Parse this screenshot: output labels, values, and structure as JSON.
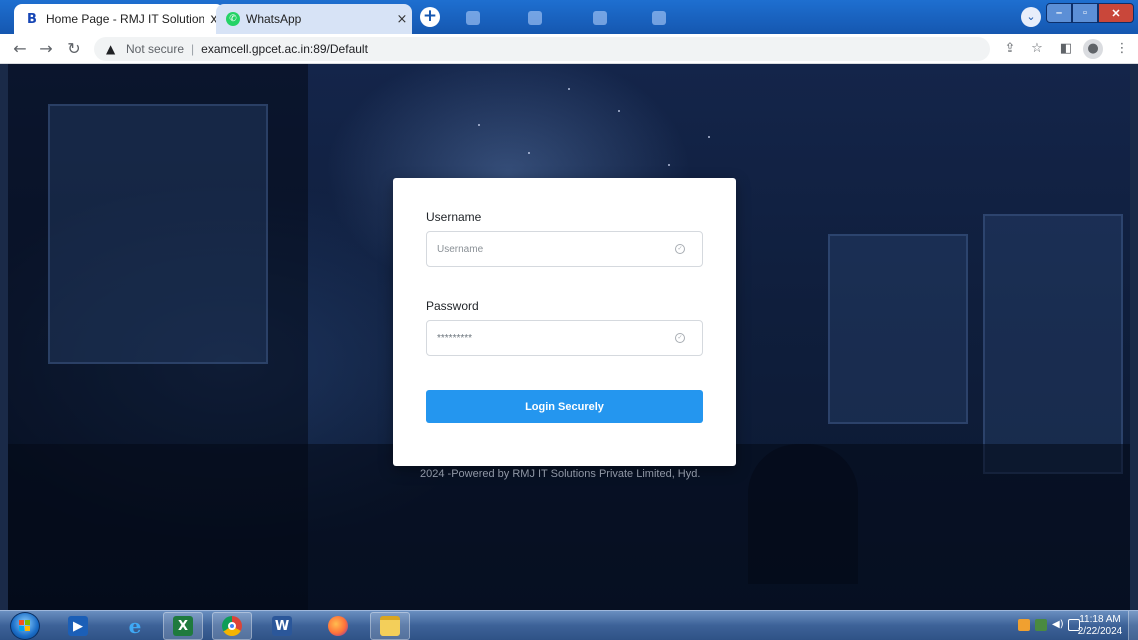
{
  "browser": {
    "tabs": [
      {
        "favicon": "B",
        "title": "Home Page - RMJ IT Solutions Pvt",
        "close": "x",
        "active": true
      },
      {
        "favicon": "whatsapp-icon",
        "title": "WhatsApp",
        "close": "×",
        "active": false
      }
    ],
    "new_tab_label": "+",
    "security_label": "Not secure",
    "url": "examcell.gpcet.ac.in:89/Default"
  },
  "login": {
    "username_label": "Username",
    "username_placeholder": "Username",
    "password_label": "Password",
    "password_value": "*********",
    "submit_label": "Login Securely"
  },
  "footer": {
    "text": "2024 -Powered by RMJ IT Solutions Private Limited, Hyd."
  },
  "taskbar": {
    "apps": [
      "start-orb",
      "media-player-icon",
      "internet-explorer-icon",
      "excel-icon",
      "chrome-icon",
      "word-icon",
      "firefox-icon",
      "file-explorer-icon"
    ],
    "clock_time": "11:18 AM",
    "clock_date": "2/22/2024"
  },
  "colors": {
    "browser_frame": "#1557b0",
    "login_button": "#2496ef",
    "page_background": "#14254a"
  }
}
